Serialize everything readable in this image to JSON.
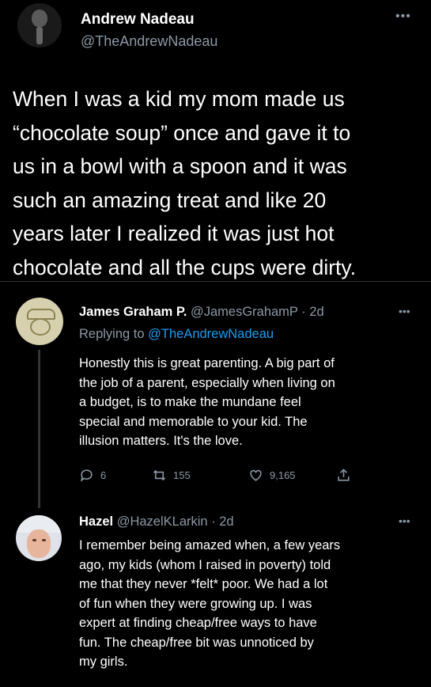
{
  "tweet": {
    "author_name": "Andrew Nadeau",
    "author_handle": "@TheAndrewNadeau",
    "more_icon": "more-icon",
    "lines": [
      "When I was a kid my mom made us",
      "“chocolate soup” once and gave it to",
      "us in a bowl with a spoon and it was",
      "such an amazing treat and like 20",
      "years later I realized it was just hot",
      "chocolate and all the cups were dirty."
    ]
  },
  "replies": [
    {
      "name": "James Graham P.",
      "handle": "@JamesGrahamP",
      "time": " · 2d",
      "replying_prefix": "Replying to ",
      "replying_to": "@TheAndrewNadeau",
      "lines": [
        "Honestly this is great parenting. A big part of",
        "the job of a parent, especially when living on",
        "a budget, is to make the mundane feel",
        "special and memorable to your kid.  The",
        "illusion matters.  It's the love."
      ],
      "replies_count": "6",
      "retweets_count": "155",
      "likes_count": "9,165"
    },
    {
      "name": "Hazel",
      "handle": "@HazelKLarkin",
      "time": " · 2d",
      "lines": [
        "I remember being amazed when, a few years",
        "ago, my kids (whom I raised in poverty) told",
        "me that they never *felt* poor. We had a lot",
        "of fun when they were growing up. I was",
        "expert at finding cheap/free ways to have",
        "fun. The cheap/free bit was unnoticed by",
        "my girls."
      ]
    }
  ],
  "colors": {
    "background": "#000000",
    "text": "#ffffff",
    "secondary": "#8b98a5",
    "link": "#1d9bf0"
  }
}
